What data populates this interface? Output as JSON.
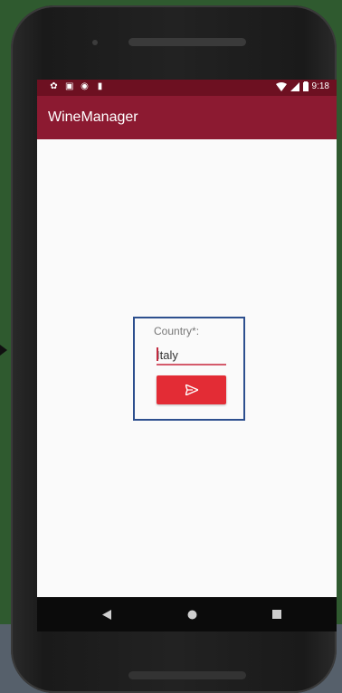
{
  "status_bar": {
    "time": "9:18",
    "left_icons": [
      "settings-icon",
      "sd-card-icon",
      "circle-icon",
      "sim-icon"
    ],
    "right_icons": [
      "wifi-icon",
      "signal-icon",
      "battery-icon"
    ]
  },
  "app_bar": {
    "title": "WineManager"
  },
  "form": {
    "country_label": "Country*:",
    "country_value": "Italy",
    "submit_icon": "send-icon"
  },
  "nav_bar": {
    "buttons": [
      "back-icon",
      "home-icon",
      "recents-icon"
    ]
  },
  "colors": {
    "status_bar": "#6d1021",
    "app_bar": "#8c1a31",
    "button": "#e32c35",
    "highlight_border": "#2d4f8e"
  }
}
